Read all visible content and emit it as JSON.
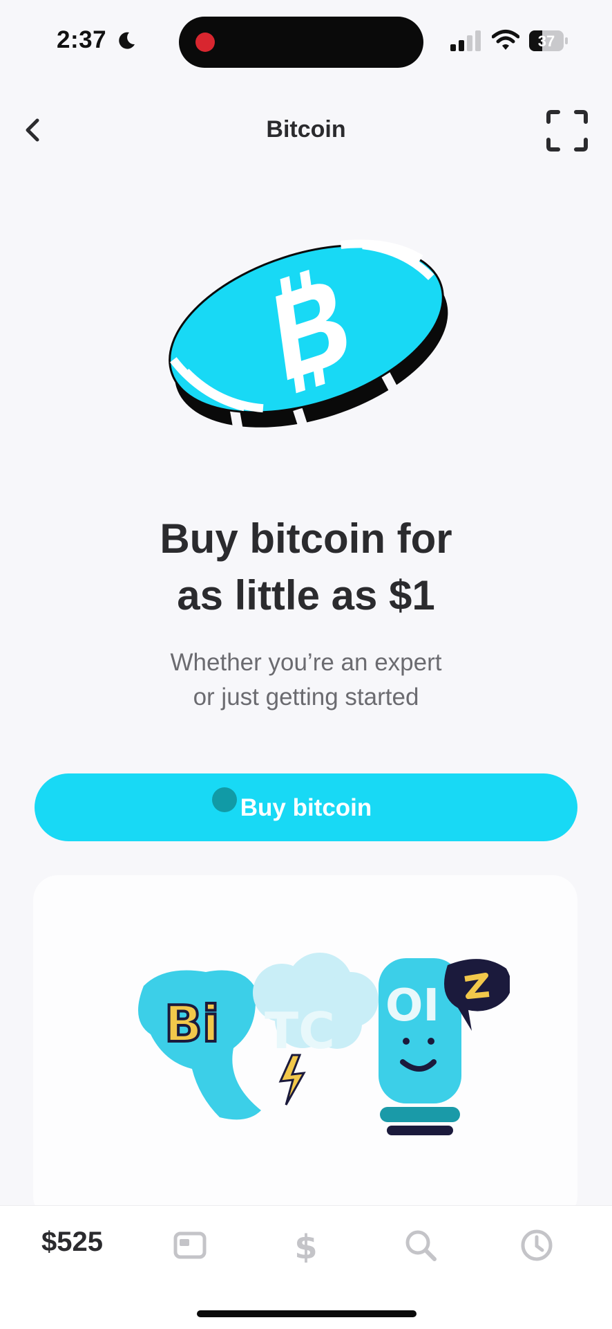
{
  "status_bar": {
    "time": "2:37",
    "battery_level": "37",
    "battery_fraction": 0.37
  },
  "nav": {
    "title": "Bitcoin"
  },
  "hero": {
    "headline_line1": "Buy bitcoin for",
    "headline_line2": "as little as $1",
    "subhead_line1": "Whether you’re an expert",
    "subhead_line2": "or just getting started"
  },
  "cta": {
    "label": "Buy bitcoin"
  },
  "tab_bar": {
    "balance": "$525",
    "icons": [
      "card-icon",
      "dollar-icon",
      "search-icon",
      "clock-icon"
    ]
  },
  "colors": {
    "accent": "#18d9f5",
    "background": "#f7f7fa",
    "text": "#2b2b2e",
    "secondary_text": "#6b6b70",
    "tab_icon": "#c4c4c8"
  }
}
